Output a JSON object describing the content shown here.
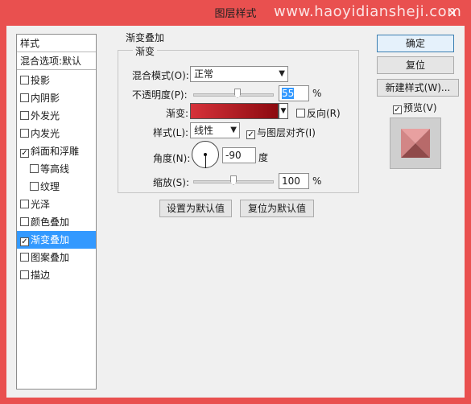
{
  "window": {
    "title": "图层样式",
    "watermark": "www.haoyidiansheji.com",
    "close_icon": "×"
  },
  "left_panel": {
    "header": "样式",
    "blend_options": "混合选项:默认",
    "items": [
      {
        "label": "投影",
        "checked": false
      },
      {
        "label": "内阴影",
        "checked": false
      },
      {
        "label": "外发光",
        "checked": false
      },
      {
        "label": "内发光",
        "checked": false
      },
      {
        "label": "斜面和浮雕",
        "checked": true
      },
      {
        "label": "等高线",
        "checked": false
      },
      {
        "label": "纹理",
        "checked": false
      },
      {
        "label": "光泽",
        "checked": false
      },
      {
        "label": "颜色叠加",
        "checked": false
      },
      {
        "label": "渐变叠加",
        "checked": true
      },
      {
        "label": "图案叠加",
        "checked": false
      },
      {
        "label": "描边",
        "checked": false
      }
    ],
    "selected_index": 9
  },
  "gradient_overlay": {
    "group_title": "渐变叠加",
    "sub_group_title": "渐变",
    "blend_mode_label": "混合模式(O):",
    "blend_mode_value": "正常",
    "opacity_label": "不透明度(P):",
    "opacity_value": "55",
    "opacity_fraction": 0.55,
    "percent": "%",
    "gradient_label": "渐变:",
    "gradient_colors": [
      "#d6323a",
      "#8c0a10"
    ],
    "reverse_label": "反向(R)",
    "reverse_checked": false,
    "style_label": "样式(L):",
    "style_value": "线性",
    "align_label": "与图层对齐(I)",
    "align_checked": true,
    "angle_label": "角度(N):",
    "angle_value": "-90",
    "degree_label": "度",
    "scale_label": "缩放(S):",
    "scale_value": "100",
    "scale_fraction": 0.5,
    "set_default_btn": "设置为默认值",
    "reset_default_btn": "复位为默认值"
  },
  "right_panel": {
    "ok_btn": "确定",
    "reset_btn": "复位",
    "new_style_btn": "新建样式(W)...",
    "preview_label": "预览(V)",
    "preview_checked": true
  },
  "colors": {
    "frame": "#e9504f",
    "selected": "#3399ff"
  }
}
